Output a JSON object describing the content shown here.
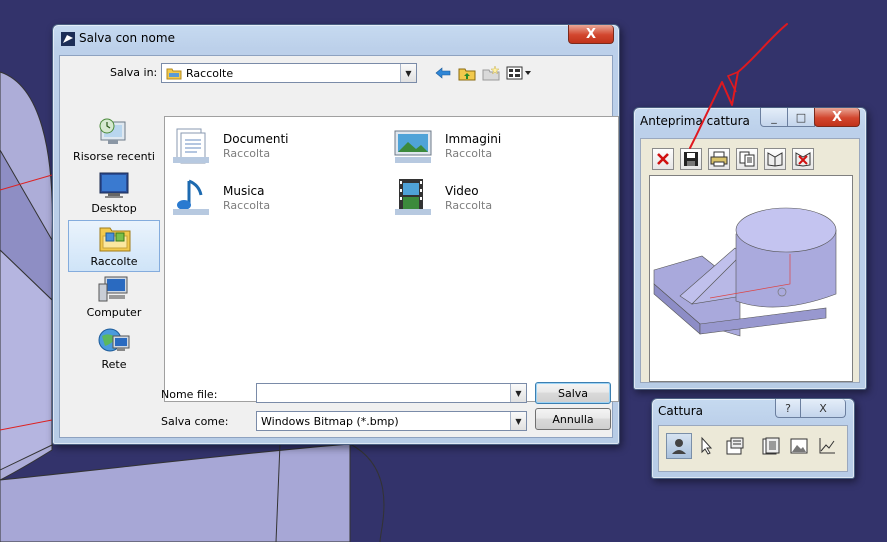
{
  "save_dialog": {
    "title": "Salva con nome",
    "save_in_label": "Salva in:",
    "save_in_value": "Raccolte",
    "places": [
      {
        "label": "Risorse recenti",
        "icon": "recent-places-icon"
      },
      {
        "label": "Desktop",
        "icon": "desktop-icon"
      },
      {
        "label": "Raccolte",
        "icon": "libraries-icon",
        "selected": true
      },
      {
        "label": "Computer",
        "icon": "computer-icon"
      },
      {
        "label": "Rete",
        "icon": "network-icon"
      }
    ],
    "items": [
      {
        "name": "Documenti",
        "sub": "Raccolta",
        "icon": "documents-library-icon"
      },
      {
        "name": "Immagini",
        "sub": "Raccolta",
        "icon": "pictures-library-icon"
      },
      {
        "name": "Musica",
        "sub": "Raccolta",
        "icon": "music-library-icon"
      },
      {
        "name": "Video",
        "sub": "Raccolta",
        "icon": "videos-library-icon"
      }
    ],
    "filename_label": "Nome file:",
    "filename_value": "",
    "filetype_label": "Salva come:",
    "filetype_value": "Windows Bitmap (*.bmp)",
    "save_button": "Salva",
    "cancel_button": "Annulla",
    "close_glyph": "X"
  },
  "preview_window": {
    "title": "Anteprima cattura",
    "tools": [
      "delete-icon",
      "save-icon",
      "print-icon",
      "copy-icon",
      "album-icon",
      "delete-album-icon"
    ],
    "min_glyph": "_",
    "max_glyph": "□",
    "close_glyph": "X"
  },
  "capture_window": {
    "title": "Cattura",
    "help_glyph": "?",
    "close_glyph": "X",
    "tools": [
      "camera-icon",
      "select-icon",
      "options-icon",
      "album-icon",
      "image-icon",
      "chart-icon"
    ]
  },
  "colors": {
    "desktop_bg": "#33336b",
    "accent_red": "#e0191f",
    "cad_face": "#a9a9dc"
  }
}
